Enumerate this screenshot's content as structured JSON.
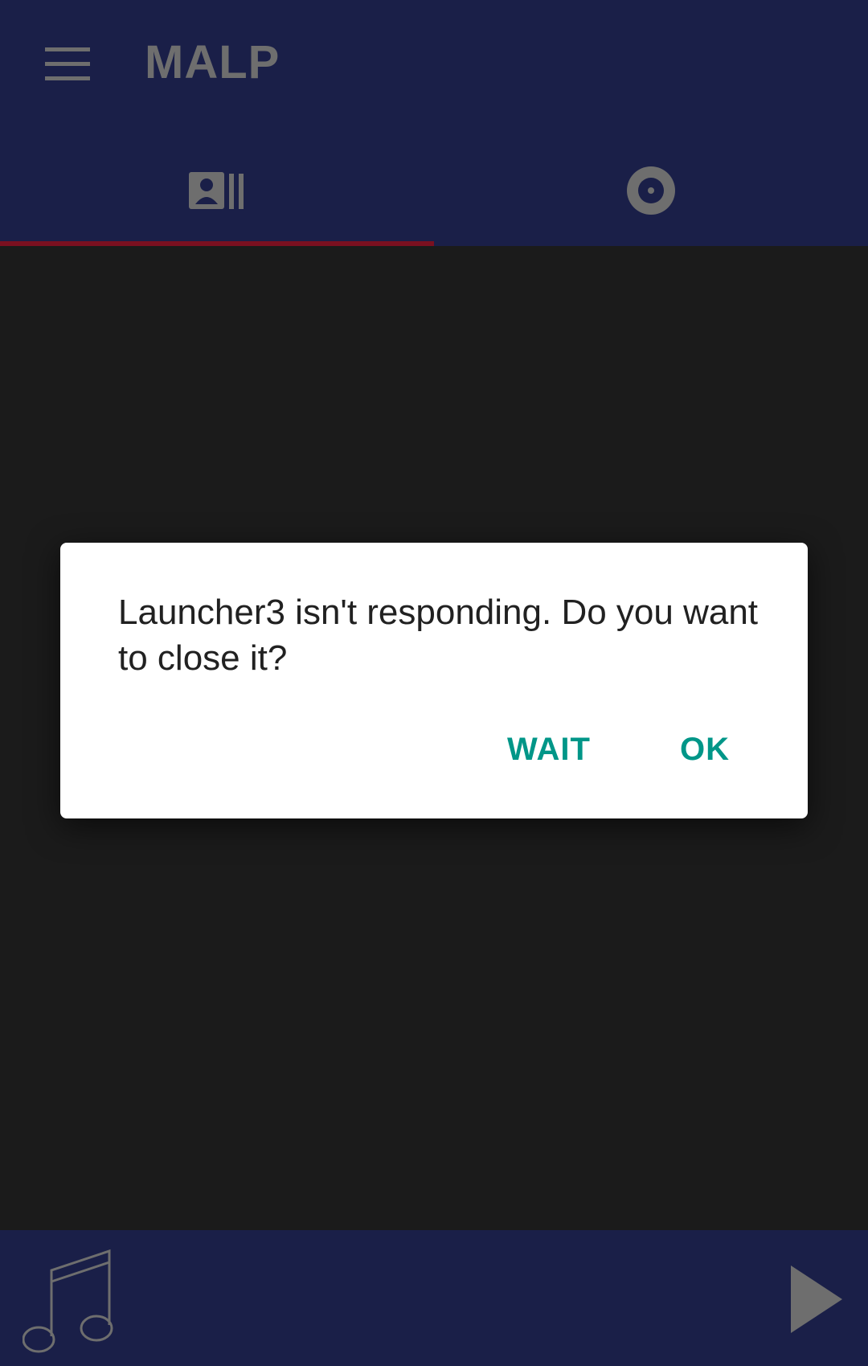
{
  "app_bar": {
    "title": "MALP",
    "menu_icon": "hamburger-menu-icon"
  },
  "tabs": [
    {
      "icon": "artist-contact-icon",
      "selected": true
    },
    {
      "icon": "album-disc-icon",
      "selected": false
    }
  ],
  "content": {
    "loading": true
  },
  "dialog": {
    "message": "Launcher3 isn't responding. Do you want to close it?",
    "wait_label": "WAIT",
    "ok_label": "OK"
  },
  "bottom_bar": {
    "cover_icon": "music-note-icon",
    "play_icon": "play-icon"
  },
  "colors": {
    "app_bar_bg": "#1a1f48",
    "content_bg": "#1b1b1b",
    "accent": "#7a1020",
    "dialog_button": "#009688",
    "icon_gray": "#6e6e6e"
  }
}
